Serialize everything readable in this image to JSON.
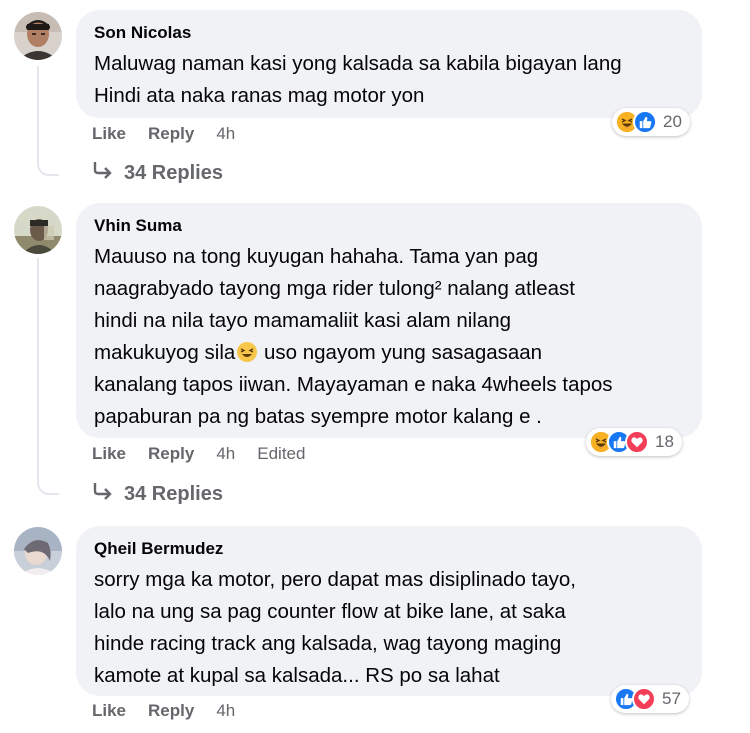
{
  "comments": [
    {
      "author": "Son Nicolas",
      "lines": [
        "Maluwag naman kasi yong kalsada sa kabila bigayan lang",
        "Hindi ata naka ranas mag motor yon"
      ],
      "like_label": "Like",
      "reply_label": "Reply",
      "time": "4h",
      "reaction_count": "20",
      "reaction_icons": [
        "haha-icon",
        "like-icon"
      ],
      "replies_label": "34 Replies"
    },
    {
      "author": "Vhin Suma",
      "lines": [
        "Mauuso na tong kuyugan hahaha. Tama yan pag",
        "naagrabyado tayong mga rider tulong² nalang atleast",
        "hindi na nila tayo mamamaliit kasi alam nilang",
        "makukuyog sila",
        "uso ngayom yung sasagasaan",
        "kanalang tapos iiwan. Mayayaman e naka 4wheels tapos",
        "papaburan pa ng batas syempre motor kalang e ."
      ],
      "like_label": "Like",
      "reply_label": "Reply",
      "time": "4h",
      "edited_label": "Edited",
      "reaction_count": "18",
      "reaction_icons": [
        "haha-icon",
        "like-icon",
        "love-icon"
      ],
      "replies_label": "34 Replies"
    },
    {
      "author": "Qheil Bermudez",
      "lines": [
        "sorry mga ka motor, pero dapat mas disiplinado tayo,",
        "lalo na ung sa pag counter flow at bike lane, at saka",
        "hinde racing track ang kalsada, wag tayong maging",
        "kamote at kupal sa kalsada... RS po sa lahat"
      ],
      "like_label": "Like",
      "reply_label": "Reply",
      "time": "4h",
      "reaction_count": "57",
      "reaction_icons": [
        "like-icon",
        "love-icon"
      ]
    }
  ],
  "colors": {
    "bubble": "#f0f2f5",
    "meta_text": "#65676b",
    "like_blue": "#1877f2",
    "love_red": "#f33e58",
    "haha_yellow": "#f7b125"
  }
}
